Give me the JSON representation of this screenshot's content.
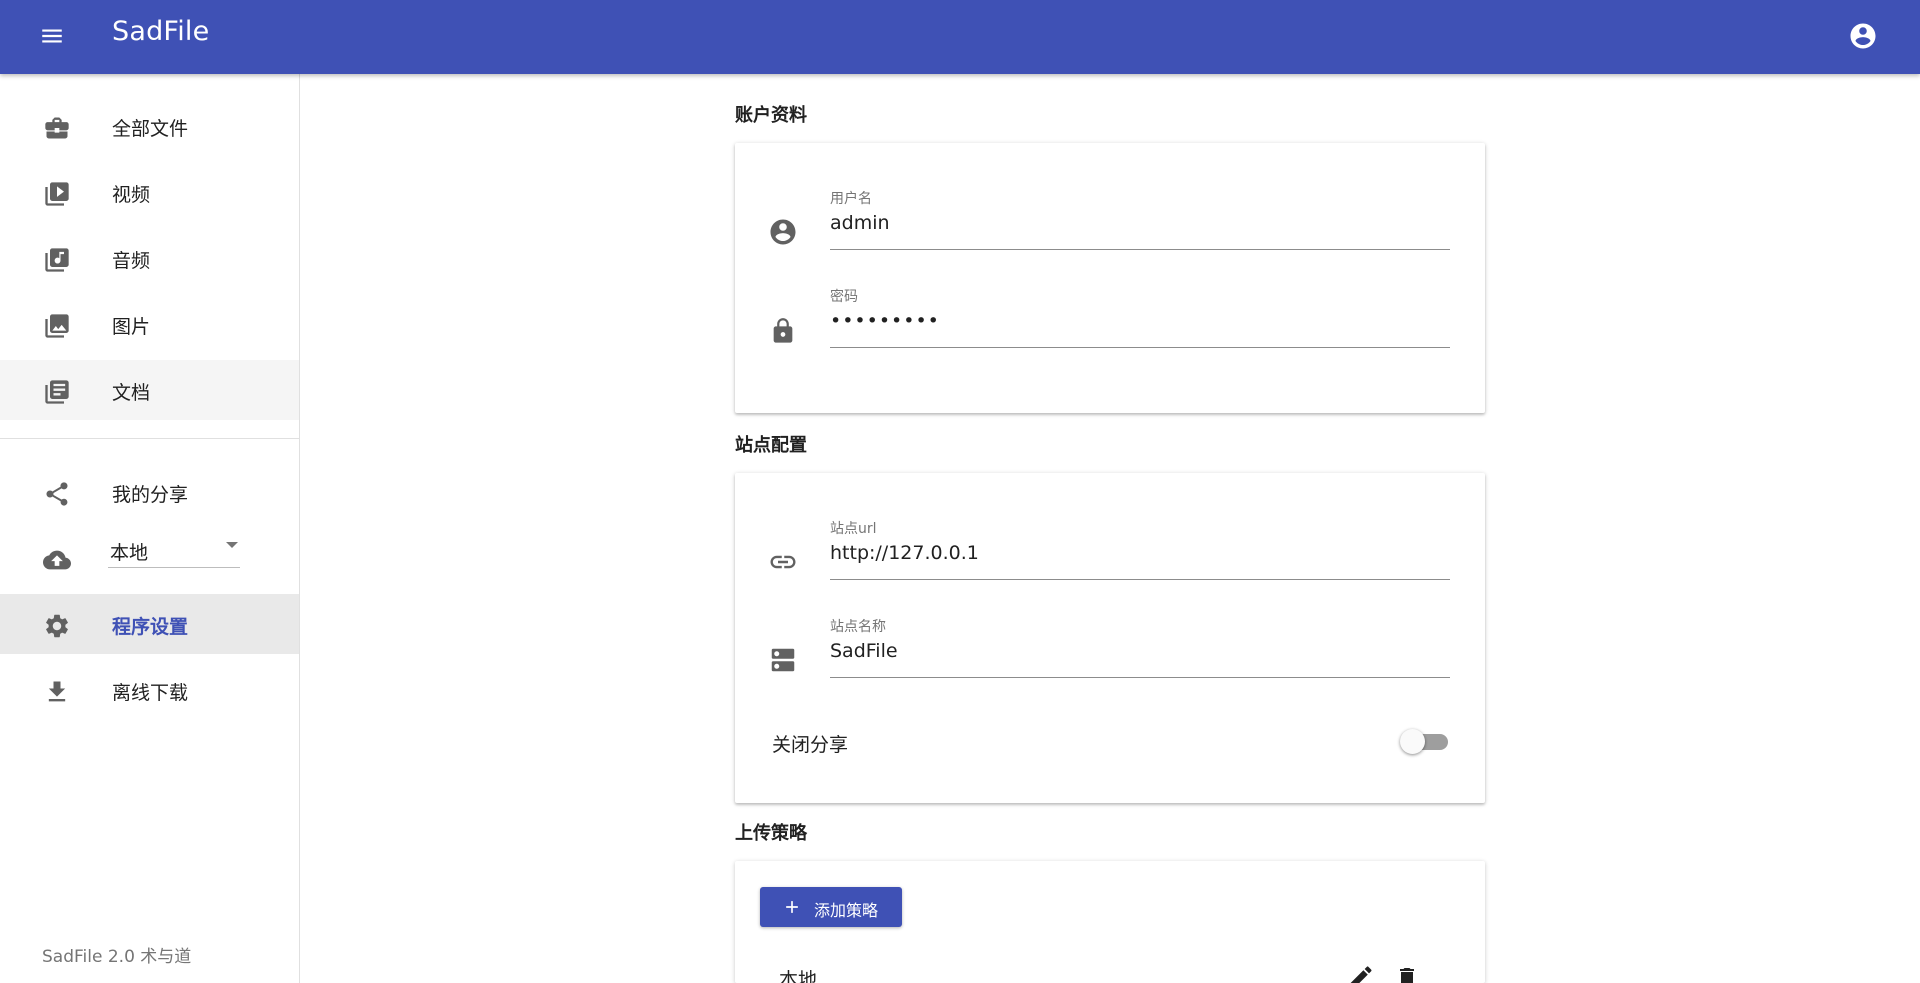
{
  "app": {
    "title": "SadFile",
    "brand_color": "#3f51b5",
    "menu_icon": "menu-icon",
    "account_icon": "account-circle-icon"
  },
  "sidebar": {
    "items": [
      {
        "label": "全部文件",
        "icon": "briefcase-icon"
      },
      {
        "label": "视频",
        "icon": "video-library-icon"
      },
      {
        "label": "音频",
        "icon": "music-library-icon"
      },
      {
        "label": "图片",
        "icon": "photo-library-icon"
      },
      {
        "label": "文档",
        "icon": "document-library-icon"
      }
    ],
    "share_label": "我的分享",
    "storage": {
      "icon": "cloud-upload-icon",
      "selected": "本地"
    },
    "settings_label": "程序设置",
    "download_label": "离线下载",
    "version": "SadFile 2.0 术与道"
  },
  "account": {
    "section_title": "账户资料",
    "username_label": "用户名",
    "username_value": "admin",
    "password_label": "密码",
    "password_value": "•••••••••"
  },
  "site": {
    "section_title": "站点配置",
    "url_label": "站点url",
    "url_value": "http://127.0.0.1",
    "name_label": "站点名称",
    "name_value": "SadFile",
    "disable_share_label": "关闭分享",
    "disable_share_on": false
  },
  "upload": {
    "section_title": "上传策略",
    "add_button_label": "添加策略",
    "policies": [
      {
        "name": "本地"
      }
    ]
  }
}
